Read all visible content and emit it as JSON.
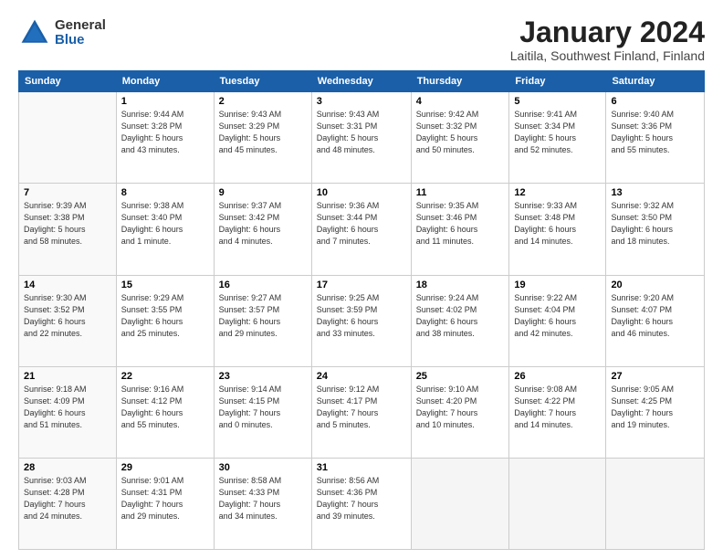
{
  "logo": {
    "general": "General",
    "blue": "Blue"
  },
  "header": {
    "month": "January 2024",
    "location": "Laitila, Southwest Finland, Finland"
  },
  "weekdays": [
    "Sunday",
    "Monday",
    "Tuesday",
    "Wednesday",
    "Thursday",
    "Friday",
    "Saturday"
  ],
  "weeks": [
    [
      {
        "num": "",
        "info": ""
      },
      {
        "num": "1",
        "info": "Sunrise: 9:44 AM\nSunset: 3:28 PM\nDaylight: 5 hours\nand 43 minutes."
      },
      {
        "num": "2",
        "info": "Sunrise: 9:43 AM\nSunset: 3:29 PM\nDaylight: 5 hours\nand 45 minutes."
      },
      {
        "num": "3",
        "info": "Sunrise: 9:43 AM\nSunset: 3:31 PM\nDaylight: 5 hours\nand 48 minutes."
      },
      {
        "num": "4",
        "info": "Sunrise: 9:42 AM\nSunset: 3:32 PM\nDaylight: 5 hours\nand 50 minutes."
      },
      {
        "num": "5",
        "info": "Sunrise: 9:41 AM\nSunset: 3:34 PM\nDaylight: 5 hours\nand 52 minutes."
      },
      {
        "num": "6",
        "info": "Sunrise: 9:40 AM\nSunset: 3:36 PM\nDaylight: 5 hours\nand 55 minutes."
      }
    ],
    [
      {
        "num": "7",
        "info": "Sunrise: 9:39 AM\nSunset: 3:38 PM\nDaylight: 5 hours\nand 58 minutes."
      },
      {
        "num": "8",
        "info": "Sunrise: 9:38 AM\nSunset: 3:40 PM\nDaylight: 6 hours\nand 1 minute."
      },
      {
        "num": "9",
        "info": "Sunrise: 9:37 AM\nSunset: 3:42 PM\nDaylight: 6 hours\nand 4 minutes."
      },
      {
        "num": "10",
        "info": "Sunrise: 9:36 AM\nSunset: 3:44 PM\nDaylight: 6 hours\nand 7 minutes."
      },
      {
        "num": "11",
        "info": "Sunrise: 9:35 AM\nSunset: 3:46 PM\nDaylight: 6 hours\nand 11 minutes."
      },
      {
        "num": "12",
        "info": "Sunrise: 9:33 AM\nSunset: 3:48 PM\nDaylight: 6 hours\nand 14 minutes."
      },
      {
        "num": "13",
        "info": "Sunrise: 9:32 AM\nSunset: 3:50 PM\nDaylight: 6 hours\nand 18 minutes."
      }
    ],
    [
      {
        "num": "14",
        "info": "Sunrise: 9:30 AM\nSunset: 3:52 PM\nDaylight: 6 hours\nand 22 minutes."
      },
      {
        "num": "15",
        "info": "Sunrise: 9:29 AM\nSunset: 3:55 PM\nDaylight: 6 hours\nand 25 minutes."
      },
      {
        "num": "16",
        "info": "Sunrise: 9:27 AM\nSunset: 3:57 PM\nDaylight: 6 hours\nand 29 minutes."
      },
      {
        "num": "17",
        "info": "Sunrise: 9:25 AM\nSunset: 3:59 PM\nDaylight: 6 hours\nand 33 minutes."
      },
      {
        "num": "18",
        "info": "Sunrise: 9:24 AM\nSunset: 4:02 PM\nDaylight: 6 hours\nand 38 minutes."
      },
      {
        "num": "19",
        "info": "Sunrise: 9:22 AM\nSunset: 4:04 PM\nDaylight: 6 hours\nand 42 minutes."
      },
      {
        "num": "20",
        "info": "Sunrise: 9:20 AM\nSunset: 4:07 PM\nDaylight: 6 hours\nand 46 minutes."
      }
    ],
    [
      {
        "num": "21",
        "info": "Sunrise: 9:18 AM\nSunset: 4:09 PM\nDaylight: 6 hours\nand 51 minutes."
      },
      {
        "num": "22",
        "info": "Sunrise: 9:16 AM\nSunset: 4:12 PM\nDaylight: 6 hours\nand 55 minutes."
      },
      {
        "num": "23",
        "info": "Sunrise: 9:14 AM\nSunset: 4:15 PM\nDaylight: 7 hours\nand 0 minutes."
      },
      {
        "num": "24",
        "info": "Sunrise: 9:12 AM\nSunset: 4:17 PM\nDaylight: 7 hours\nand 5 minutes."
      },
      {
        "num": "25",
        "info": "Sunrise: 9:10 AM\nSunset: 4:20 PM\nDaylight: 7 hours\nand 10 minutes."
      },
      {
        "num": "26",
        "info": "Sunrise: 9:08 AM\nSunset: 4:22 PM\nDaylight: 7 hours\nand 14 minutes."
      },
      {
        "num": "27",
        "info": "Sunrise: 9:05 AM\nSunset: 4:25 PM\nDaylight: 7 hours\nand 19 minutes."
      }
    ],
    [
      {
        "num": "28",
        "info": "Sunrise: 9:03 AM\nSunset: 4:28 PM\nDaylight: 7 hours\nand 24 minutes."
      },
      {
        "num": "29",
        "info": "Sunrise: 9:01 AM\nSunset: 4:31 PM\nDaylight: 7 hours\nand 29 minutes."
      },
      {
        "num": "30",
        "info": "Sunrise: 8:58 AM\nSunset: 4:33 PM\nDaylight: 7 hours\nand 34 minutes."
      },
      {
        "num": "31",
        "info": "Sunrise: 8:56 AM\nSunset: 4:36 PM\nDaylight: 7 hours\nand 39 minutes."
      },
      {
        "num": "",
        "info": ""
      },
      {
        "num": "",
        "info": ""
      },
      {
        "num": "",
        "info": ""
      }
    ]
  ]
}
